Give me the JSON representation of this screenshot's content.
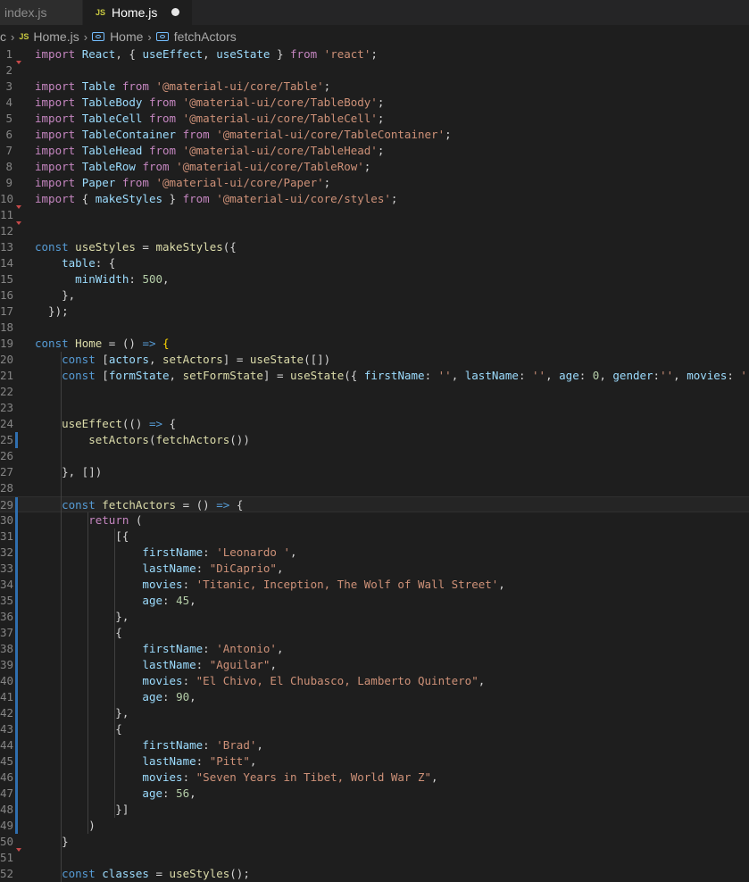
{
  "tabs": [
    {
      "label": "index.js",
      "active": false
    },
    {
      "label": "Home.js",
      "active": true,
      "badge": "JS",
      "dirty": true
    }
  ],
  "breadcrumb": {
    "items": [
      {
        "label": "c",
        "icon": null
      },
      {
        "label": "Home.js",
        "icon": "js-file-icon",
        "badge": "JS"
      },
      {
        "label": "Home",
        "icon": "symbol-variable-icon"
      },
      {
        "label": "fetchActors",
        "icon": "symbol-variable-icon"
      }
    ]
  },
  "colors": {
    "background": "#1e1e1e",
    "keyword": "#c586c0",
    "storage": "#569cd6",
    "variable": "#9cdcfe",
    "function": "#dcdcaa",
    "string": "#ce9178",
    "number": "#b5cea8",
    "line_number": "#858585",
    "modified_gutter": "#2f6fb0"
  },
  "editor": {
    "active_line": 29,
    "lines": [
      {
        "n": "1",
        "t": [
          [
            "k",
            "import"
          ],
          [
            "p",
            " "
          ],
          [
            "v",
            "React"
          ],
          [
            "p",
            ", { "
          ],
          [
            "v",
            "useEffect"
          ],
          [
            "p",
            ", "
          ],
          [
            "v",
            "useState"
          ],
          [
            "p",
            " } "
          ],
          [
            "k",
            "from"
          ],
          [
            "p",
            " "
          ],
          [
            "s",
            "'react'"
          ],
          [
            "p",
            ";"
          ]
        ]
      },
      {
        "n": "2",
        "t": []
      },
      {
        "n": "3",
        "t": [
          [
            "k",
            "import"
          ],
          [
            "p",
            " "
          ],
          [
            "v",
            "Table"
          ],
          [
            "p",
            " "
          ],
          [
            "k",
            "from"
          ],
          [
            "p",
            " "
          ],
          [
            "s",
            "'@material-ui/core/Table'"
          ],
          [
            "p",
            ";"
          ]
        ]
      },
      {
        "n": "4",
        "t": [
          [
            "k",
            "import"
          ],
          [
            "p",
            " "
          ],
          [
            "v",
            "TableBody"
          ],
          [
            "p",
            " "
          ],
          [
            "k",
            "from"
          ],
          [
            "p",
            " "
          ],
          [
            "s",
            "'@material-ui/core/TableBody'"
          ],
          [
            "p",
            ";"
          ]
        ]
      },
      {
        "n": "5",
        "t": [
          [
            "k",
            "import"
          ],
          [
            "p",
            " "
          ],
          [
            "v",
            "TableCell"
          ],
          [
            "p",
            " "
          ],
          [
            "k",
            "from"
          ],
          [
            "p",
            " "
          ],
          [
            "s",
            "'@material-ui/core/TableCell'"
          ],
          [
            "p",
            ";"
          ]
        ]
      },
      {
        "n": "6",
        "t": [
          [
            "k",
            "import"
          ],
          [
            "p",
            " "
          ],
          [
            "v",
            "TableContainer"
          ],
          [
            "p",
            " "
          ],
          [
            "k",
            "from"
          ],
          [
            "p",
            " "
          ],
          [
            "s",
            "'@material-ui/core/TableContainer'"
          ],
          [
            "p",
            ";"
          ]
        ]
      },
      {
        "n": "7",
        "t": [
          [
            "k",
            "import"
          ],
          [
            "p",
            " "
          ],
          [
            "v",
            "TableHead"
          ],
          [
            "p",
            " "
          ],
          [
            "k",
            "from"
          ],
          [
            "p",
            " "
          ],
          [
            "s",
            "'@material-ui/core/TableHead'"
          ],
          [
            "p",
            ";"
          ]
        ]
      },
      {
        "n": "8",
        "t": [
          [
            "k",
            "import"
          ],
          [
            "p",
            " "
          ],
          [
            "v",
            "TableRow"
          ],
          [
            "p",
            " "
          ],
          [
            "k",
            "from"
          ],
          [
            "p",
            " "
          ],
          [
            "s",
            "'@material-ui/core/TableRow'"
          ],
          [
            "p",
            ";"
          ]
        ]
      },
      {
        "n": "9",
        "t": [
          [
            "k",
            "import"
          ],
          [
            "p",
            " "
          ],
          [
            "v",
            "Paper"
          ],
          [
            "p",
            " "
          ],
          [
            "k",
            "from"
          ],
          [
            "p",
            " "
          ],
          [
            "s",
            "'@material-ui/core/Paper'"
          ],
          [
            "p",
            ";"
          ]
        ]
      },
      {
        "n": "10",
        "t": [
          [
            "k",
            "import"
          ],
          [
            "p",
            " { "
          ],
          [
            "v",
            "makeStyles"
          ],
          [
            "p",
            " } "
          ],
          [
            "k",
            "from"
          ],
          [
            "p",
            " "
          ],
          [
            "s",
            "'@material-ui/core/styles'"
          ],
          [
            "p",
            ";"
          ]
        ]
      },
      {
        "n": "11",
        "t": []
      },
      {
        "n": "12",
        "t": []
      },
      {
        "n": "13",
        "t": [
          [
            "b",
            "const"
          ],
          [
            "p",
            " "
          ],
          [
            "f",
            "useStyles"
          ],
          [
            "p",
            " = "
          ],
          [
            "f",
            "makeStyles"
          ],
          [
            "p",
            "({"
          ]
        ]
      },
      {
        "n": "14",
        "t": [
          [
            "p",
            "    "
          ],
          [
            "v",
            "table"
          ],
          [
            "p",
            ": {"
          ]
        ]
      },
      {
        "n": "15",
        "t": [
          [
            "p",
            "      "
          ],
          [
            "v",
            "minWidth"
          ],
          [
            "p",
            ": "
          ],
          [
            "n",
            "500"
          ],
          [
            "p",
            ","
          ]
        ]
      },
      {
        "n": "16",
        "t": [
          [
            "p",
            "    },"
          ]
        ]
      },
      {
        "n": "17",
        "t": [
          [
            "p",
            "  });"
          ]
        ]
      },
      {
        "n": "18",
        "t": []
      },
      {
        "n": "19",
        "t": [
          [
            "b",
            "const"
          ],
          [
            "p",
            " "
          ],
          [
            "f",
            "Home"
          ],
          [
            "p",
            " = () "
          ],
          [
            "b",
            "=>"
          ],
          [
            "p",
            " "
          ],
          [
            "br",
            "{"
          ]
        ]
      },
      {
        "n": "20",
        "t": [
          [
            "p",
            "    "
          ],
          [
            "b",
            "const"
          ],
          [
            "p",
            " ["
          ],
          [
            "v",
            "actors"
          ],
          [
            "p",
            ", "
          ],
          [
            "f",
            "setActors"
          ],
          [
            "p",
            "] = "
          ],
          [
            "f",
            "useState"
          ],
          [
            "p",
            "([])"
          ]
        ]
      },
      {
        "n": "21",
        "t": [
          [
            "p",
            "    "
          ],
          [
            "b",
            "const"
          ],
          [
            "p",
            " ["
          ],
          [
            "v",
            "formState"
          ],
          [
            "p",
            ", "
          ],
          [
            "f",
            "setFormState"
          ],
          [
            "p",
            "] = "
          ],
          [
            "f",
            "useState"
          ],
          [
            "p",
            "({ "
          ],
          [
            "v",
            "firstName"
          ],
          [
            "p",
            ": "
          ],
          [
            "s",
            "''"
          ],
          [
            "p",
            ", "
          ],
          [
            "v",
            "lastName"
          ],
          [
            "p",
            ": "
          ],
          [
            "s",
            "''"
          ],
          [
            "p",
            ", "
          ],
          [
            "v",
            "age"
          ],
          [
            "p",
            ": "
          ],
          [
            "n",
            "0"
          ],
          [
            "p",
            ", "
          ],
          [
            "v",
            "gender"
          ],
          [
            "p",
            ":"
          ],
          [
            "s",
            "''"
          ],
          [
            "p",
            ", "
          ],
          [
            "v",
            "movies"
          ],
          [
            "p",
            ": "
          ],
          [
            "s",
            "''"
          ],
          [
            "p",
            " })"
          ]
        ]
      },
      {
        "n": "22",
        "t": []
      },
      {
        "n": "23",
        "t": []
      },
      {
        "n": "24",
        "t": [
          [
            "p",
            "    "
          ],
          [
            "f",
            "useEffect"
          ],
          [
            "p",
            "(() "
          ],
          [
            "b",
            "=>"
          ],
          [
            "p",
            " {"
          ]
        ]
      },
      {
        "n": "25",
        "t": [
          [
            "p",
            "        "
          ],
          [
            "f",
            "setActors"
          ],
          [
            "p",
            "("
          ],
          [
            "f",
            "fetchActors"
          ],
          [
            "p",
            "())"
          ]
        ]
      },
      {
        "n": "26",
        "t": []
      },
      {
        "n": "27",
        "t": [
          [
            "p",
            "    }, [])"
          ]
        ]
      },
      {
        "n": "28",
        "t": []
      },
      {
        "n": "29",
        "t": [
          [
            "p",
            "    "
          ],
          [
            "b",
            "const"
          ],
          [
            "p",
            " "
          ],
          [
            "f",
            "fetchActors"
          ],
          [
            "p",
            " = () "
          ],
          [
            "b",
            "=>"
          ],
          [
            "p",
            " {"
          ]
        ]
      },
      {
        "n": "30",
        "t": [
          [
            "p",
            "        "
          ],
          [
            "k",
            "return"
          ],
          [
            "p",
            " ("
          ]
        ]
      },
      {
        "n": "31",
        "t": [
          [
            "p",
            "            [{"
          ]
        ]
      },
      {
        "n": "32",
        "t": [
          [
            "p",
            "                "
          ],
          [
            "v",
            "firstName"
          ],
          [
            "p",
            ": "
          ],
          [
            "s",
            "'Leonardo '"
          ],
          [
            "p",
            ","
          ]
        ]
      },
      {
        "n": "33",
        "t": [
          [
            "p",
            "                "
          ],
          [
            "v",
            "lastName"
          ],
          [
            "p",
            ": "
          ],
          [
            "s",
            "\"DiCaprio\""
          ],
          [
            "p",
            ","
          ]
        ]
      },
      {
        "n": "34",
        "t": [
          [
            "p",
            "                "
          ],
          [
            "v",
            "movies"
          ],
          [
            "p",
            ": "
          ],
          [
            "s",
            "'Titanic, Inception, The Wolf of Wall Street'"
          ],
          [
            "p",
            ","
          ]
        ]
      },
      {
        "n": "35",
        "t": [
          [
            "p",
            "                "
          ],
          [
            "v",
            "age"
          ],
          [
            "p",
            ": "
          ],
          [
            "n",
            "45"
          ],
          [
            "p",
            ","
          ]
        ]
      },
      {
        "n": "36",
        "t": [
          [
            "p",
            "            },"
          ]
        ]
      },
      {
        "n": "37",
        "t": [
          [
            "p",
            "            {"
          ]
        ]
      },
      {
        "n": "38",
        "t": [
          [
            "p",
            "                "
          ],
          [
            "v",
            "firstName"
          ],
          [
            "p",
            ": "
          ],
          [
            "s",
            "'Antonio'"
          ],
          [
            "p",
            ","
          ]
        ]
      },
      {
        "n": "39",
        "t": [
          [
            "p",
            "                "
          ],
          [
            "v",
            "lastName"
          ],
          [
            "p",
            ": "
          ],
          [
            "s",
            "\"Aguilar\""
          ],
          [
            "p",
            ","
          ]
        ]
      },
      {
        "n": "40",
        "t": [
          [
            "p",
            "                "
          ],
          [
            "v",
            "movies"
          ],
          [
            "p",
            ": "
          ],
          [
            "s",
            "\"El Chivo, El Chubasco, Lamberto Quintero\""
          ],
          [
            "p",
            ","
          ]
        ]
      },
      {
        "n": "41",
        "t": [
          [
            "p",
            "                "
          ],
          [
            "v",
            "age"
          ],
          [
            "p",
            ": "
          ],
          [
            "n",
            "90"
          ],
          [
            "p",
            ","
          ]
        ]
      },
      {
        "n": "42",
        "t": [
          [
            "p",
            "            },"
          ]
        ]
      },
      {
        "n": "43",
        "t": [
          [
            "p",
            "            {"
          ]
        ]
      },
      {
        "n": "44",
        "t": [
          [
            "p",
            "                "
          ],
          [
            "v",
            "firstName"
          ],
          [
            "p",
            ": "
          ],
          [
            "s",
            "'Brad'"
          ],
          [
            "p",
            ","
          ]
        ]
      },
      {
        "n": "45",
        "t": [
          [
            "p",
            "                "
          ],
          [
            "v",
            "lastName"
          ],
          [
            "p",
            ": "
          ],
          [
            "s",
            "\"Pitt\""
          ],
          [
            "p",
            ","
          ]
        ]
      },
      {
        "n": "46",
        "t": [
          [
            "p",
            "                "
          ],
          [
            "v",
            "movies"
          ],
          [
            "p",
            ": "
          ],
          [
            "s",
            "\"Seven Years in Tibet, World War Z\""
          ],
          [
            "p",
            ","
          ]
        ]
      },
      {
        "n": "47",
        "t": [
          [
            "p",
            "                "
          ],
          [
            "v",
            "age"
          ],
          [
            "p",
            ": "
          ],
          [
            "n",
            "56"
          ],
          [
            "p",
            ","
          ]
        ]
      },
      {
        "n": "48",
        "t": [
          [
            "p",
            "            }]"
          ]
        ]
      },
      {
        "n": "49",
        "t": [
          [
            "p",
            "        )"
          ]
        ]
      },
      {
        "n": "50",
        "t": [
          [
            "p",
            "    }"
          ]
        ]
      },
      {
        "n": "51",
        "t": []
      },
      {
        "n": "52",
        "t": [
          [
            "p",
            "    "
          ],
          [
            "b",
            "const"
          ],
          [
            "p",
            " "
          ],
          [
            "v",
            "classes"
          ],
          [
            "p",
            " = "
          ],
          [
            "f",
            "useStyles"
          ],
          [
            "p",
            "();"
          ]
        ]
      }
    ]
  }
}
